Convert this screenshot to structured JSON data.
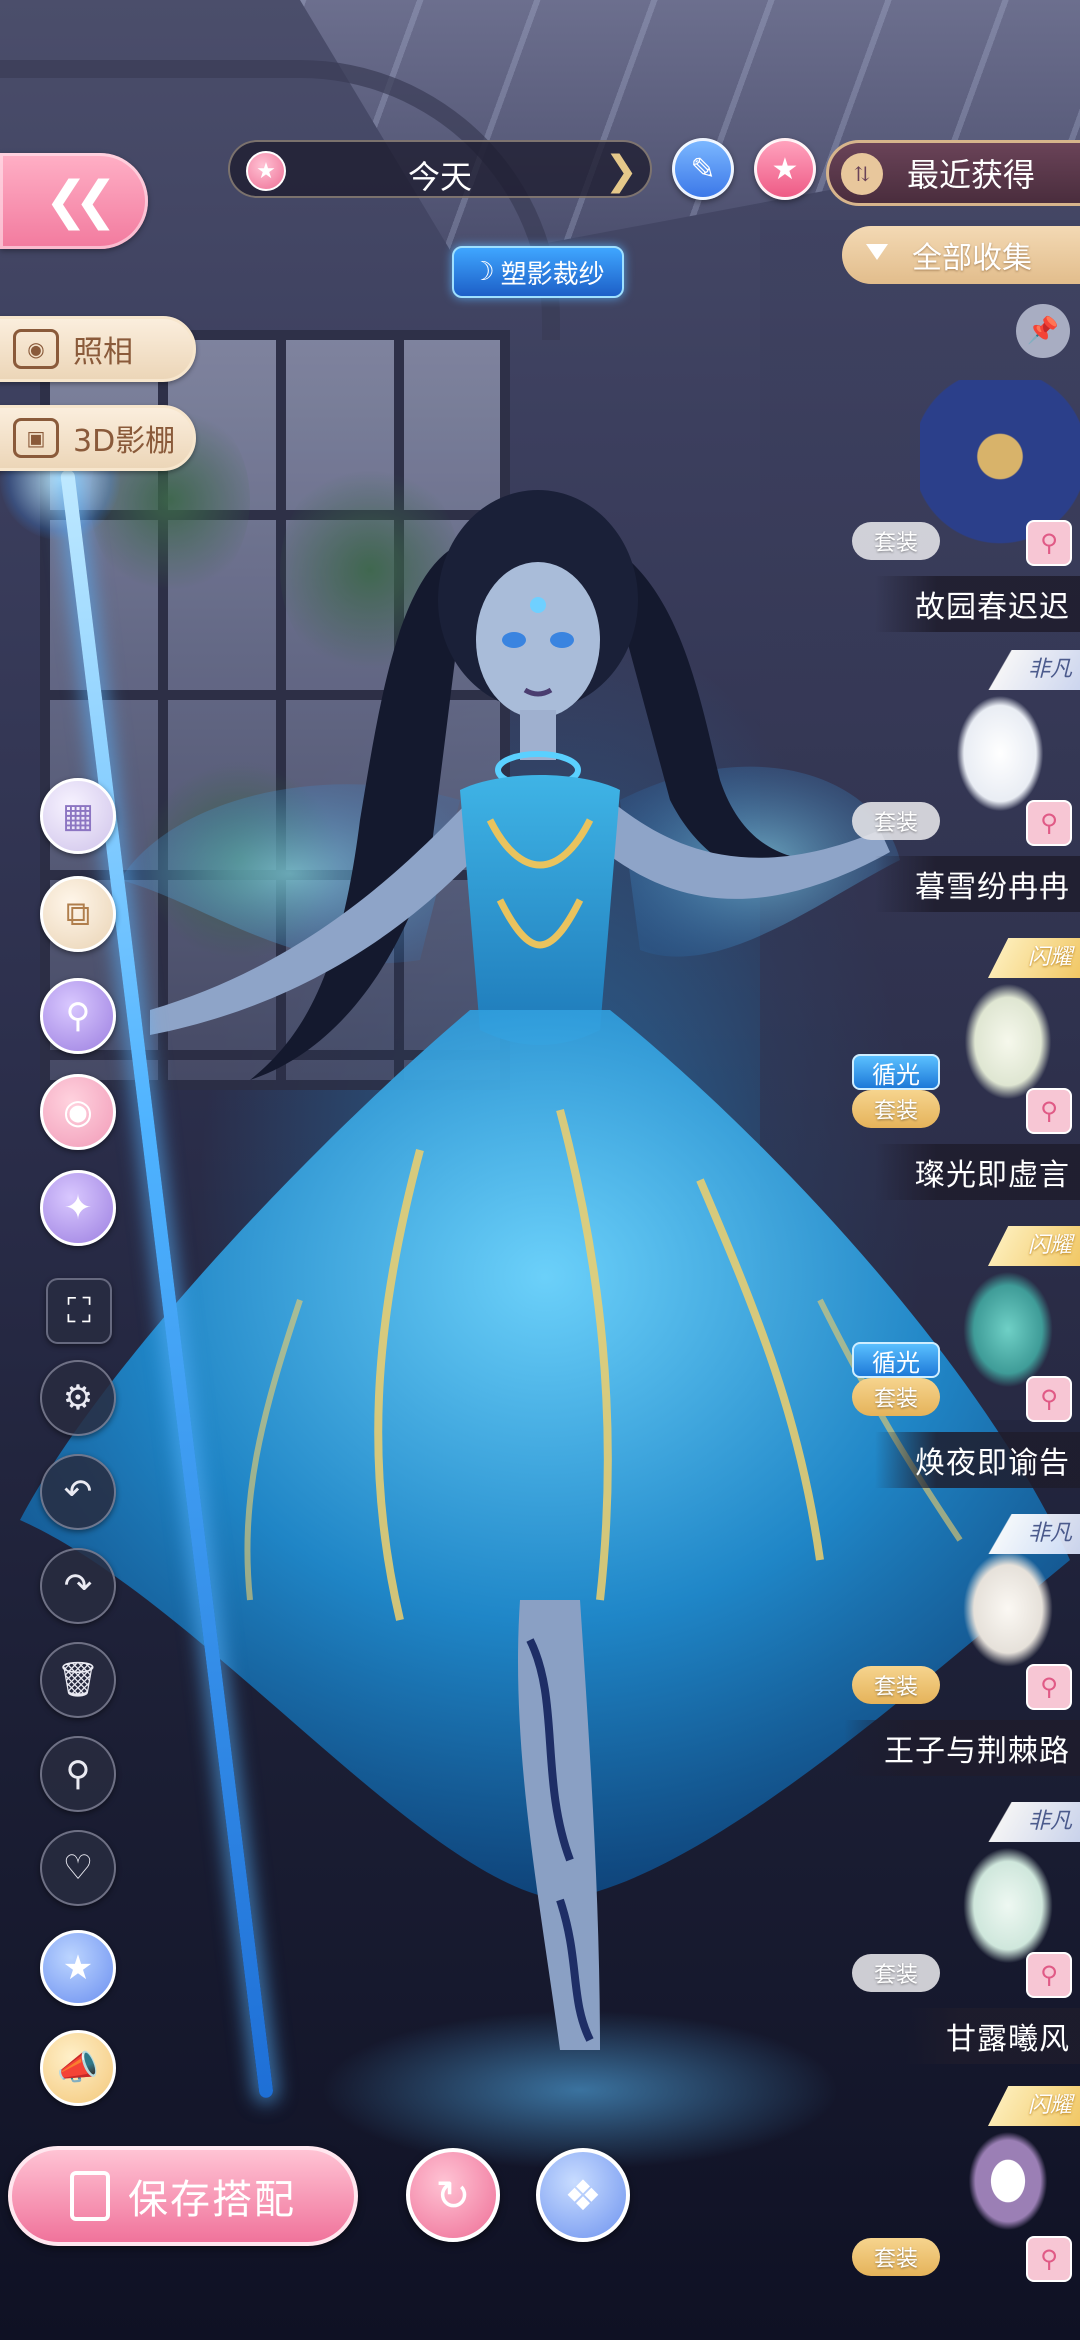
{
  "header": {
    "back_icon": "double-chevron-left",
    "date_label": "今天",
    "recent_label": "最近获得",
    "all_label": "全部收集",
    "outfit_tag": "塑影裁纱"
  },
  "left_buttons": {
    "photo_label": "照相",
    "studio_label": "3D影棚"
  },
  "tools": [
    "camera-filter-icon",
    "copy-icon",
    "search-person-icon",
    "palette-icon",
    "magic-star-icon",
    "fullscreen-icon",
    "gear-icon",
    "undo-icon",
    "redo-icon",
    "trash-icon",
    "search-icon",
    "heart-icon",
    "star-badge-icon",
    "megaphone-icon"
  ],
  "bottom": {
    "save_label": "保存搭配"
  },
  "items": [
    {
      "name": "故园春迟迟",
      "set": "套装",
      "rarity": "",
      "effect": "",
      "color": "#2b3f8a"
    },
    {
      "name": "暮雪纷冉冉",
      "set": "套装",
      "rarity": "非凡",
      "effect": "",
      "color": "#e9edf4"
    },
    {
      "name": "璨光即虚言",
      "set": "套装",
      "rarity": "闪耀",
      "effect": "循光",
      "color": "#dfe6d2"
    },
    {
      "name": "焕夜即谕告",
      "set": "套装",
      "rarity": "闪耀",
      "effect": "循光",
      "color": "#3f9c98"
    },
    {
      "name": "王子与荆棘路",
      "set": "套装",
      "rarity": "非凡",
      "effect": "",
      "color": "#e6e1da"
    },
    {
      "name": "甘露曦风",
      "set": "套装",
      "rarity": "非凡",
      "effect": "",
      "color": "#cfe7dc"
    },
    {
      "name": "",
      "set": "套装",
      "rarity": "闪耀",
      "effect": "",
      "color": "#9b7fb5"
    }
  ],
  "colors": {
    "pink": "#f27a9e",
    "gold": "#e2bd8c",
    "blue": "#3c78e8"
  }
}
